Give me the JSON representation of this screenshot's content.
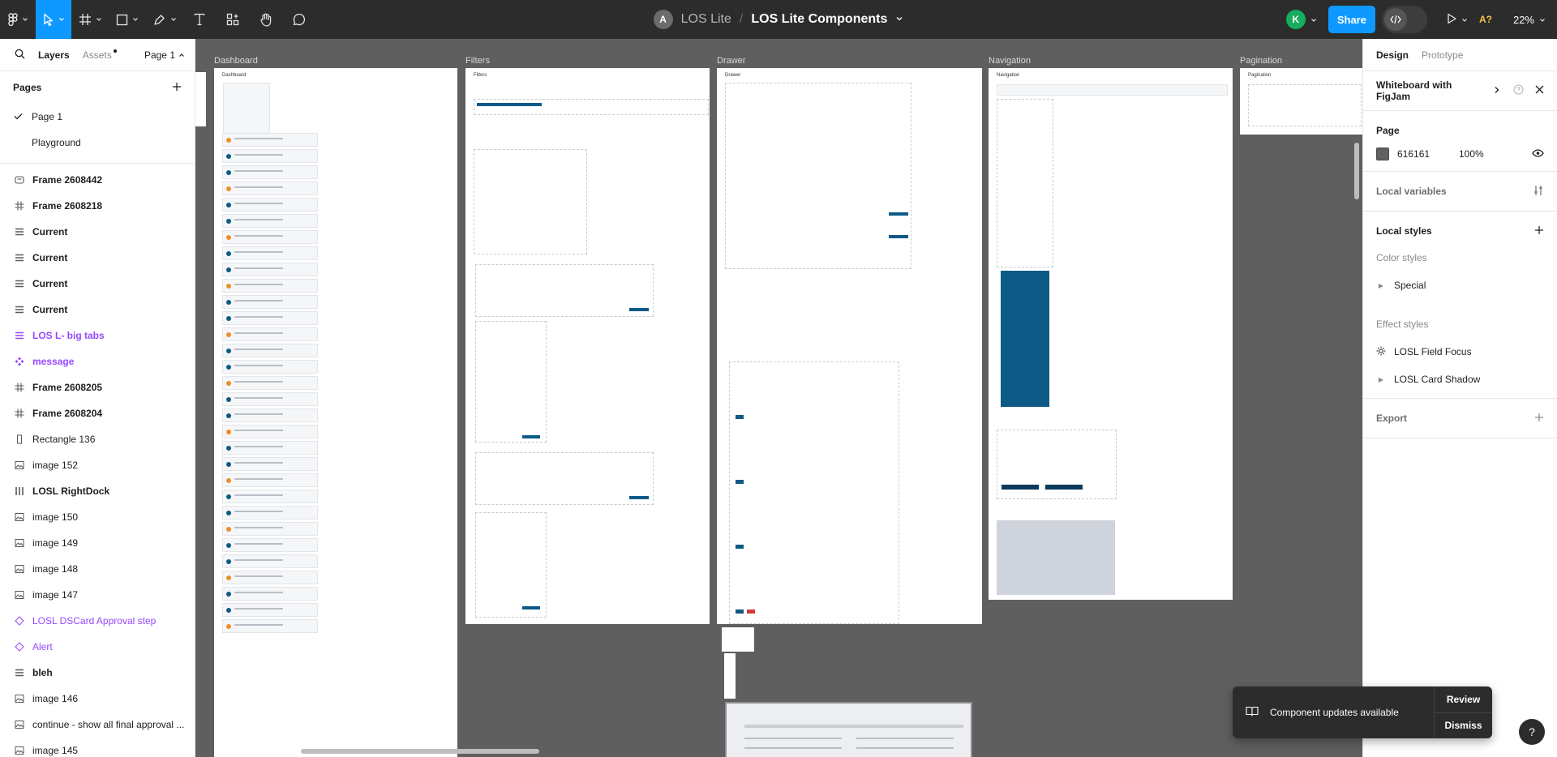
{
  "toolbar": {
    "project": "LOS Lite",
    "separator": "/",
    "file_name": "LOS Lite Components",
    "team_initial": "A",
    "user_initial": "K",
    "share_label": "Share",
    "a11y_label": "A?",
    "zoom_label": "22%",
    "accent_color": "#0d99ff"
  },
  "left_panel": {
    "tabs": [
      "Layers",
      "Assets"
    ],
    "page_selector": "Page 1",
    "pages_title": "Pages",
    "pages": [
      {
        "label": "Page 1",
        "selected": true
      },
      {
        "label": "Playground",
        "selected": false
      }
    ],
    "layers": [
      {
        "label": "Frame 2608442",
        "icon": "section-icon"
      },
      {
        "label": "Frame 2608218",
        "icon": "frame-icon"
      },
      {
        "label": "Current",
        "icon": "text-lines-icon"
      },
      {
        "label": "Current",
        "icon": "text-lines-icon"
      },
      {
        "label": "Current",
        "icon": "text-lines-icon"
      },
      {
        "label": "Current",
        "icon": "text-lines-icon"
      },
      {
        "label": "LOS L- big tabs",
        "icon": "text-lines-icon"
      },
      {
        "label": "message",
        "icon": "component-icon"
      },
      {
        "label": "Frame 2608205",
        "icon": "frame-icon"
      },
      {
        "label": "Frame 2608204",
        "icon": "frame-icon"
      },
      {
        "label": "Rectangle 136",
        "icon": "rectangle-icon"
      },
      {
        "label": "image 152",
        "icon": "image-icon"
      },
      {
        "label": "LOSL RightDock",
        "icon": "columns-icon"
      },
      {
        "label": "image 150",
        "icon": "image-icon"
      },
      {
        "label": "image 149",
        "icon": "image-icon"
      },
      {
        "label": "image 148",
        "icon": "image-icon"
      },
      {
        "label": "image 147",
        "icon": "image-icon"
      },
      {
        "label": "LOSL DSCard Approval step",
        "icon": "instance-icon"
      },
      {
        "label": "Alert",
        "icon": "instance-icon"
      },
      {
        "label": "bleh",
        "icon": "text-lines-icon"
      },
      {
        "label": "image 146",
        "icon": "image-icon"
      },
      {
        "label": "continue - show all final approval ...",
        "icon": "image-icon"
      },
      {
        "label": "image 145",
        "icon": "image-icon"
      }
    ]
  },
  "canvas": {
    "frames": [
      "Dashboard",
      "Filters",
      "Drawer",
      "Navigation",
      "Pagination"
    ]
  },
  "right_panel": {
    "tabs": [
      "Design",
      "Prototype"
    ],
    "whiteboard_label": "Whiteboard with FigJam",
    "page_section": "Page",
    "page_color_hex": "616161",
    "page_opacity": "100%",
    "local_variables": "Local variables",
    "local_styles": "Local styles",
    "color_styles": "Color styles",
    "color_style_items": [
      "Special"
    ],
    "effect_styles": "Effect styles",
    "effect_items": [
      "LOSL Field Focus",
      "LOSL Card Shadow"
    ],
    "export": "Export"
  },
  "toast": {
    "message": "Component updates available",
    "review": "Review",
    "dismiss": "Dismiss"
  },
  "help_label": "?"
}
